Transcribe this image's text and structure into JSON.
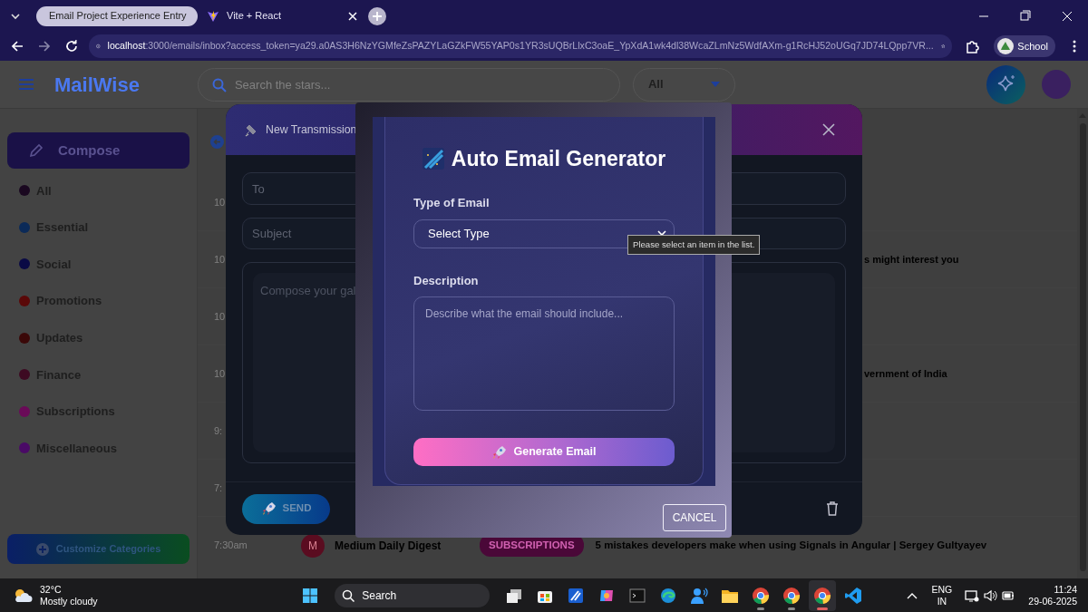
{
  "browser": {
    "tabs": [
      {
        "title": "Email Project Experience Entry",
        "selected": true,
        "kind": "globe"
      },
      {
        "title": "Vite + React",
        "selected": false,
        "kind": "vite"
      }
    ],
    "forward_enabled": false,
    "address": {
      "host": "localhost",
      "path": ":3000/emails/inbox?access_token=ya29.a0AS3H6NzYGMfeZsPAZYLaGZkFW55YAP0s1YR3sUQBrLlxC3oaE_YpXdA1wk4dl38WcaZLmNz5WdfAXm-g1RcHJ52oUGq7JD74LQpp7VR..."
    },
    "profile": "School"
  },
  "app": {
    "brand": "MailWise",
    "search_placeholder": "Search the stars...",
    "filter": "All"
  },
  "sidebar": {
    "compose": "Compose",
    "categories": [
      {
        "label": "All",
        "color": "#1a0820"
      },
      {
        "label": "Essential",
        "color": "#0b2a58"
      },
      {
        "label": "Social",
        "color": "#0a0a45"
      },
      {
        "label": "Promotions",
        "color": "#5a0808"
      },
      {
        "label": "Updates",
        "color": "#3a0808"
      },
      {
        "label": "Finance",
        "color": "#3d0a22"
      },
      {
        "label": "Subscriptions",
        "color": "#6a0a58"
      },
      {
        "label": "Miscellaneous",
        "color": "#4a0a66"
      }
    ],
    "customize": "Customize Categories"
  },
  "inbox": {
    "rows": [
      {
        "kind": "partial",
        "time": "10"
      },
      {
        "kind": "partial",
        "time": "10",
        "subject": "s might interest you"
      },
      {
        "kind": "partial",
        "time": "10"
      },
      {
        "kind": "partial",
        "time": "10",
        "subject": "vernment of India"
      },
      {
        "kind": "partial",
        "time": "9:"
      },
      {
        "kind": "partial",
        "time": "7:"
      },
      {
        "kind": "full",
        "time": "7:30am",
        "avatar": "M",
        "sender": "Medium Daily Digest",
        "tag": "SUBSCRIPTIONS",
        "subject": "5 mistakes developers make when using Signals in Angular | Sergey Gultyayev"
      }
    ]
  },
  "compose": {
    "title": "New Transmission",
    "to_placeholder": "To",
    "subject_placeholder": "Subject",
    "body_placeholder": "Compose your gal",
    "send": "SEND"
  },
  "generator": {
    "title": "Auto Email Generator",
    "type_label": "Type of Email",
    "type_value": "Select Type",
    "description_label": "Description",
    "description_placeholder": "Describe what the email should include...",
    "generate": "Generate Email",
    "cancel": "CANCEL"
  },
  "tooltip": "Please select an item in the list.",
  "taskbar": {
    "weather": {
      "temperature": "32°C",
      "condition": "Mostly cloudy"
    },
    "search": "Search",
    "apps": [
      {
        "kind": "windows",
        "running": false,
        "active": false
      },
      {
        "kind": "taskview",
        "running": false,
        "active": false
      },
      {
        "kind": "store",
        "running": false,
        "active": false
      },
      {
        "kind": "pen",
        "running": false,
        "active": false
      },
      {
        "kind": "copilot",
        "running": false,
        "active": false
      },
      {
        "kind": "terminal",
        "running": false,
        "active": false
      },
      {
        "kind": "edge",
        "running": false,
        "active": false
      },
      {
        "kind": "people",
        "running": false,
        "active": false
      },
      {
        "kind": "folder",
        "running": false,
        "active": false
      },
      {
        "kind": "chrome",
        "running": true,
        "active": false
      },
      {
        "kind": "chrome",
        "running": true,
        "active": false
      },
      {
        "kind": "chrome",
        "running": true,
        "active": true
      },
      {
        "kind": "code",
        "running": false,
        "active": false
      }
    ],
    "language": "ENG",
    "region": "IN",
    "time": "11:24",
    "date": "29-06-2025"
  }
}
